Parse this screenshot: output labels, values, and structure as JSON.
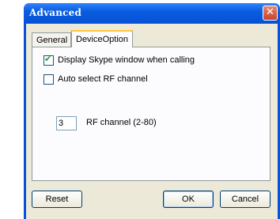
{
  "window": {
    "title": "Advanced",
    "close_icon": "close-icon"
  },
  "tabs": [
    {
      "label": "General",
      "selected": false
    },
    {
      "label": "DeviceOption",
      "selected": true
    }
  ],
  "device_option": {
    "display_skype_window": {
      "label": "Display Skype window when calling",
      "checked": true
    },
    "auto_select_rf": {
      "label": "Auto select RF channel",
      "checked": false
    },
    "rf_channel": {
      "value": "3",
      "label": "RF channel (2-80)"
    }
  },
  "buttons": {
    "reset": "Reset",
    "ok": "OK",
    "cancel": "Cancel"
  }
}
